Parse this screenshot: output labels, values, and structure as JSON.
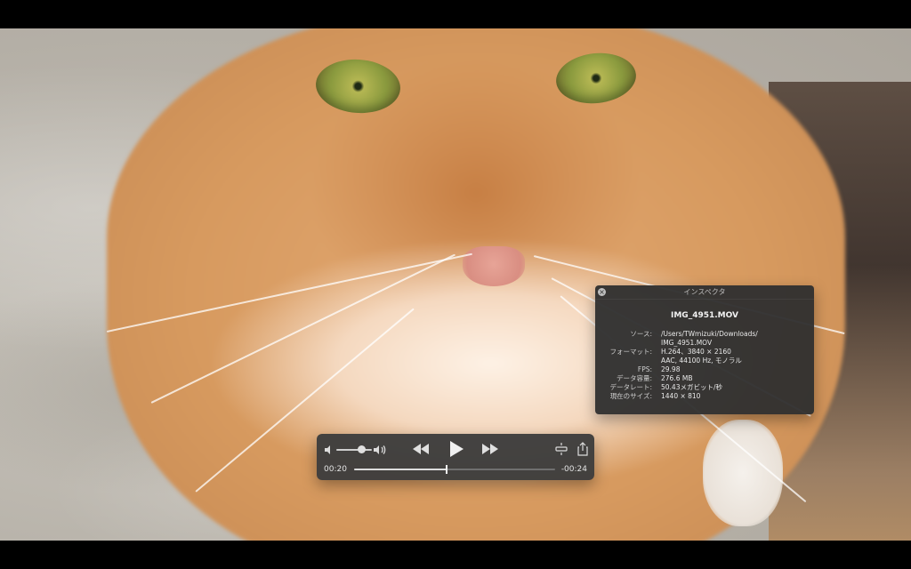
{
  "player": {
    "inspector": {
      "title": "インスペクタ",
      "filename": "IMG_4951.MOV",
      "rows": [
        {
          "key": "ソース:",
          "value": "/Users/TWmizuki/Downloads/"
        },
        {
          "key": "",
          "value": "IMG_4951.MOV"
        },
        {
          "key": "フォーマット:",
          "value": "H.264、3840 × 2160"
        },
        {
          "key": "",
          "value": "AAC, 44100 Hz, モノラル"
        },
        {
          "key": "FPS:",
          "value": "29.98"
        },
        {
          "key": "データ容量:",
          "value": "276.6 MB"
        },
        {
          "key": "データレート:",
          "value": "50.43メガビット/秒"
        },
        {
          "key": "現在のサイズ:",
          "value": "1440 × 810"
        }
      ]
    },
    "controls": {
      "elapsed": "00:20",
      "remaining": "-00:24",
      "progress_fraction": 0.458,
      "volume_fraction": 0.72
    }
  }
}
